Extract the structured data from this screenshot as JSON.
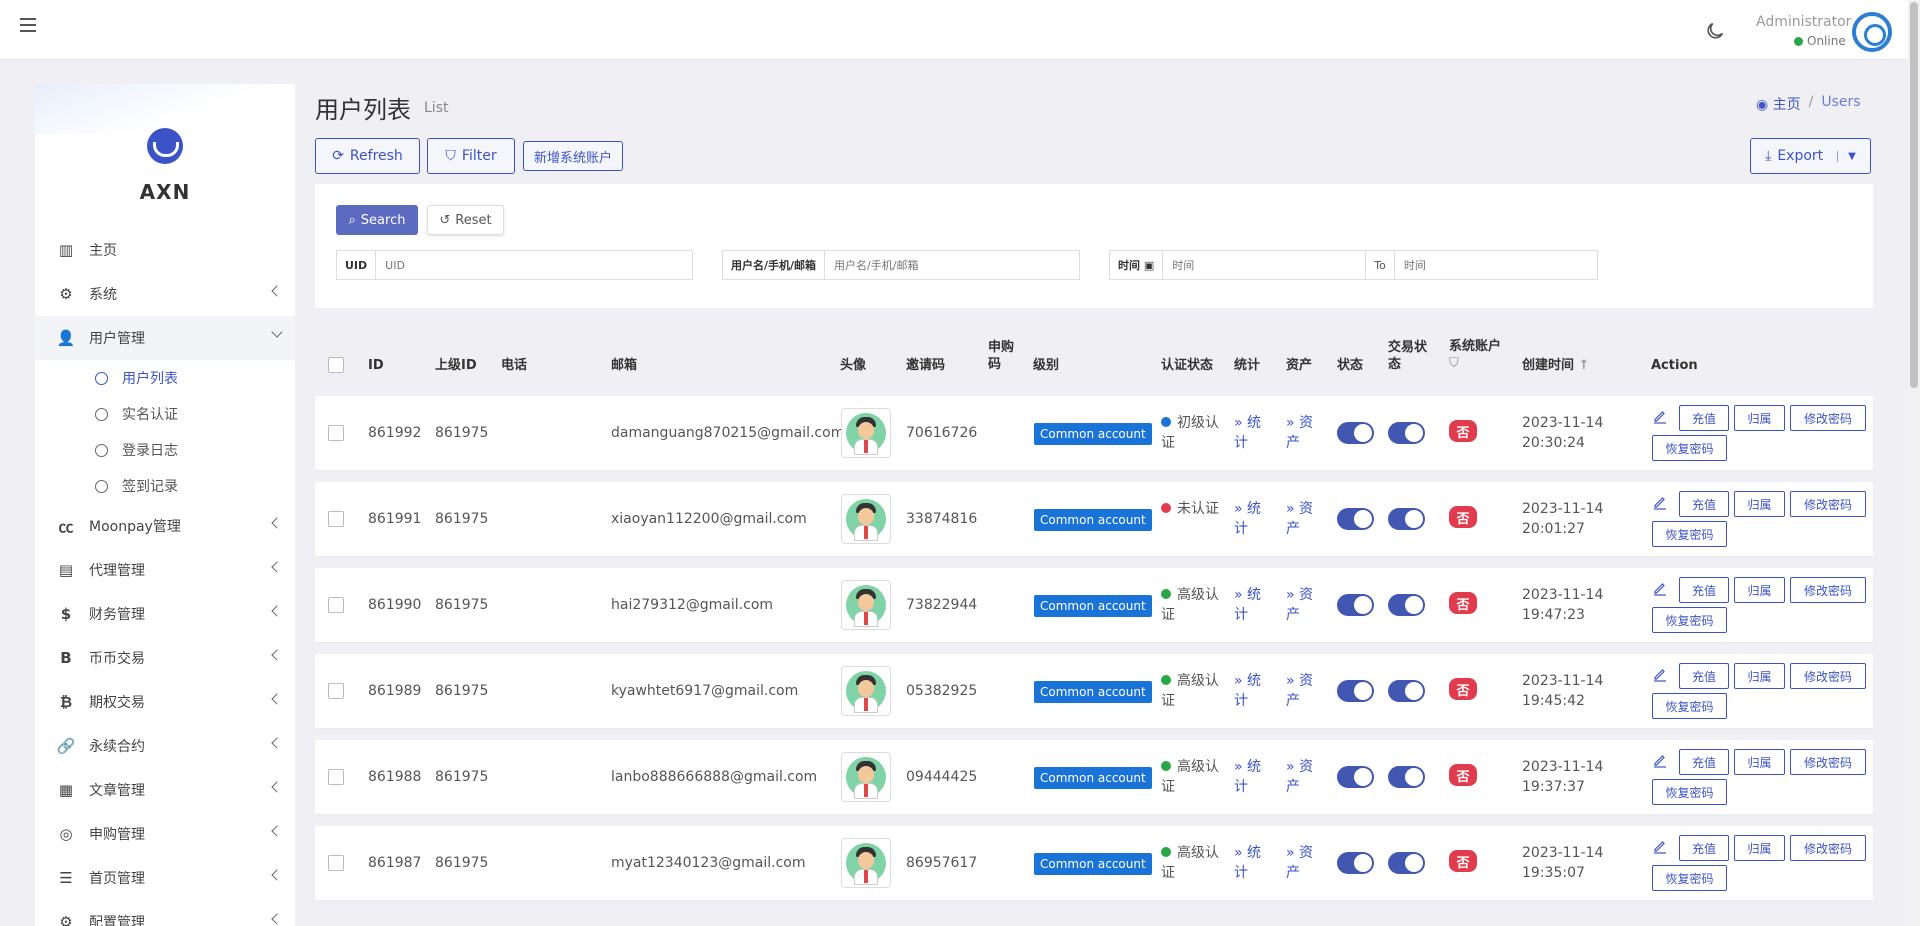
{
  "header": {
    "admin_name": "Administrator",
    "status": "Online"
  },
  "sidebar": {
    "brand": "AXN",
    "items": [
      {
        "label": "主页",
        "icon": "bar-chart-icon",
        "glyph": "▥"
      },
      {
        "label": "系统",
        "icon": "gear-icon",
        "glyph": "⚙"
      },
      {
        "label": "用户管理",
        "icon": "user-icon",
        "glyph": "👤",
        "open": true
      },
      {
        "label": "Moonpay管理",
        "icon": "cc-icon",
        "glyph": "㏄"
      },
      {
        "label": "代理管理",
        "icon": "id-card-icon",
        "glyph": "▤"
      },
      {
        "label": "财务管理",
        "icon": "dollar-icon",
        "glyph": "$"
      },
      {
        "label": "币币交易",
        "icon": "bitcoin-b-icon",
        "glyph": "B"
      },
      {
        "label": "期权交易",
        "icon": "bitcoin-icon",
        "glyph": "₿"
      },
      {
        "label": "永续合约",
        "icon": "link-icon",
        "glyph": "🔗"
      },
      {
        "label": "文章管理",
        "icon": "newspaper-icon",
        "glyph": "▦"
      },
      {
        "label": "申购管理",
        "icon": "lifebuoy-icon",
        "glyph": "◎"
      },
      {
        "label": "首页管理",
        "icon": "list-icon",
        "glyph": "☰"
      },
      {
        "label": "配置管理",
        "icon": "cog-icon",
        "glyph": "⚙"
      }
    ],
    "sub_items": [
      "用户列表",
      "实名认证",
      "登录日志",
      "签到记录"
    ]
  },
  "page": {
    "title": "用户列表",
    "subtitle": "List",
    "breadcrumb_home": "主页",
    "breadcrumb_current": "Users"
  },
  "toolbar": {
    "refresh": "Refresh",
    "filter": "Filter",
    "add_system_account": "新增系统账户",
    "export": "Export"
  },
  "filter": {
    "search": "Search",
    "reset": "Reset",
    "uid_label": "UID",
    "uid_placeholder": "UID",
    "user_label": "用户名/手机/邮箱",
    "user_placeholder": "用户名/手机/邮箱",
    "time_label": "时间",
    "time_from_placeholder": "时间",
    "to_label": "To",
    "time_to_placeholder": "时间"
  },
  "table": {
    "headers": {
      "id": "ID",
      "parent_id": "上级ID",
      "phone": "电话",
      "email": "邮箱",
      "avatar": "头像",
      "invite": "邀请码",
      "purchase": "申购码",
      "level": "级别",
      "auth": "认证状态",
      "stats": "统计",
      "assets": "资产",
      "status": "状态",
      "trade_status": "交易状态",
      "system_account": "系统账户",
      "created": "创建时间",
      "action": "Action"
    },
    "rows": [
      {
        "id": "861992",
        "parent": "861975",
        "email": "damanguang870215@gmail.com",
        "invite": "70616726",
        "level": "Common account",
        "auth": "初级认证",
        "auth_color": "#1a73d6",
        "stats": "» 统计",
        "assets": "» 资产",
        "system": "否",
        "date": "2023-11-14",
        "time": "20:30:24"
      },
      {
        "id": "861991",
        "parent": "861975",
        "email": "xiaoyan112200@gmail.com",
        "invite": "33874816",
        "level": "Common account",
        "auth": "未认证",
        "auth_color": "#e03c4e",
        "stats": "» 统计",
        "assets": "» 资产",
        "system": "否",
        "date": "2023-11-14",
        "time": "20:01:27"
      },
      {
        "id": "861990",
        "parent": "861975",
        "email": "hai279312@gmail.com",
        "invite": "73822944",
        "level": "Common account",
        "auth": "高级认证",
        "auth_color": "#28a745",
        "stats": "» 统计",
        "assets": "» 资产",
        "system": "否",
        "date": "2023-11-14",
        "time": "19:47:23"
      },
      {
        "id": "861989",
        "parent": "861975",
        "email": "kyawhtet6917@gmail.com",
        "invite": "05382925",
        "level": "Common account",
        "auth": "高级认证",
        "auth_color": "#28a745",
        "stats": "» 统计",
        "assets": "» 资产",
        "system": "否",
        "date": "2023-11-14",
        "time": "19:45:42"
      },
      {
        "id": "861988",
        "parent": "861975",
        "email": "lanbo888666888@gmail.com",
        "invite": "09444425",
        "level": "Common account",
        "auth": "高级认证",
        "auth_color": "#28a745",
        "stats": "» 统计",
        "assets": "» 资产",
        "system": "否",
        "date": "2023-11-14",
        "time": "19:37:37"
      },
      {
        "id": "861987",
        "parent": "861975",
        "email": "myat12340123@gmail.com",
        "invite": "86957617",
        "level": "Common account",
        "auth": "高级认证",
        "auth_color": "#28a745",
        "stats": "» 统计",
        "assets": "» 资产",
        "system": "否",
        "date": "2023-11-14",
        "time": "19:35:07"
      }
    ],
    "actions": {
      "recharge": "充值",
      "belong": "归属",
      "change_password": "修改密码",
      "reset_password": "恢复密码"
    }
  }
}
